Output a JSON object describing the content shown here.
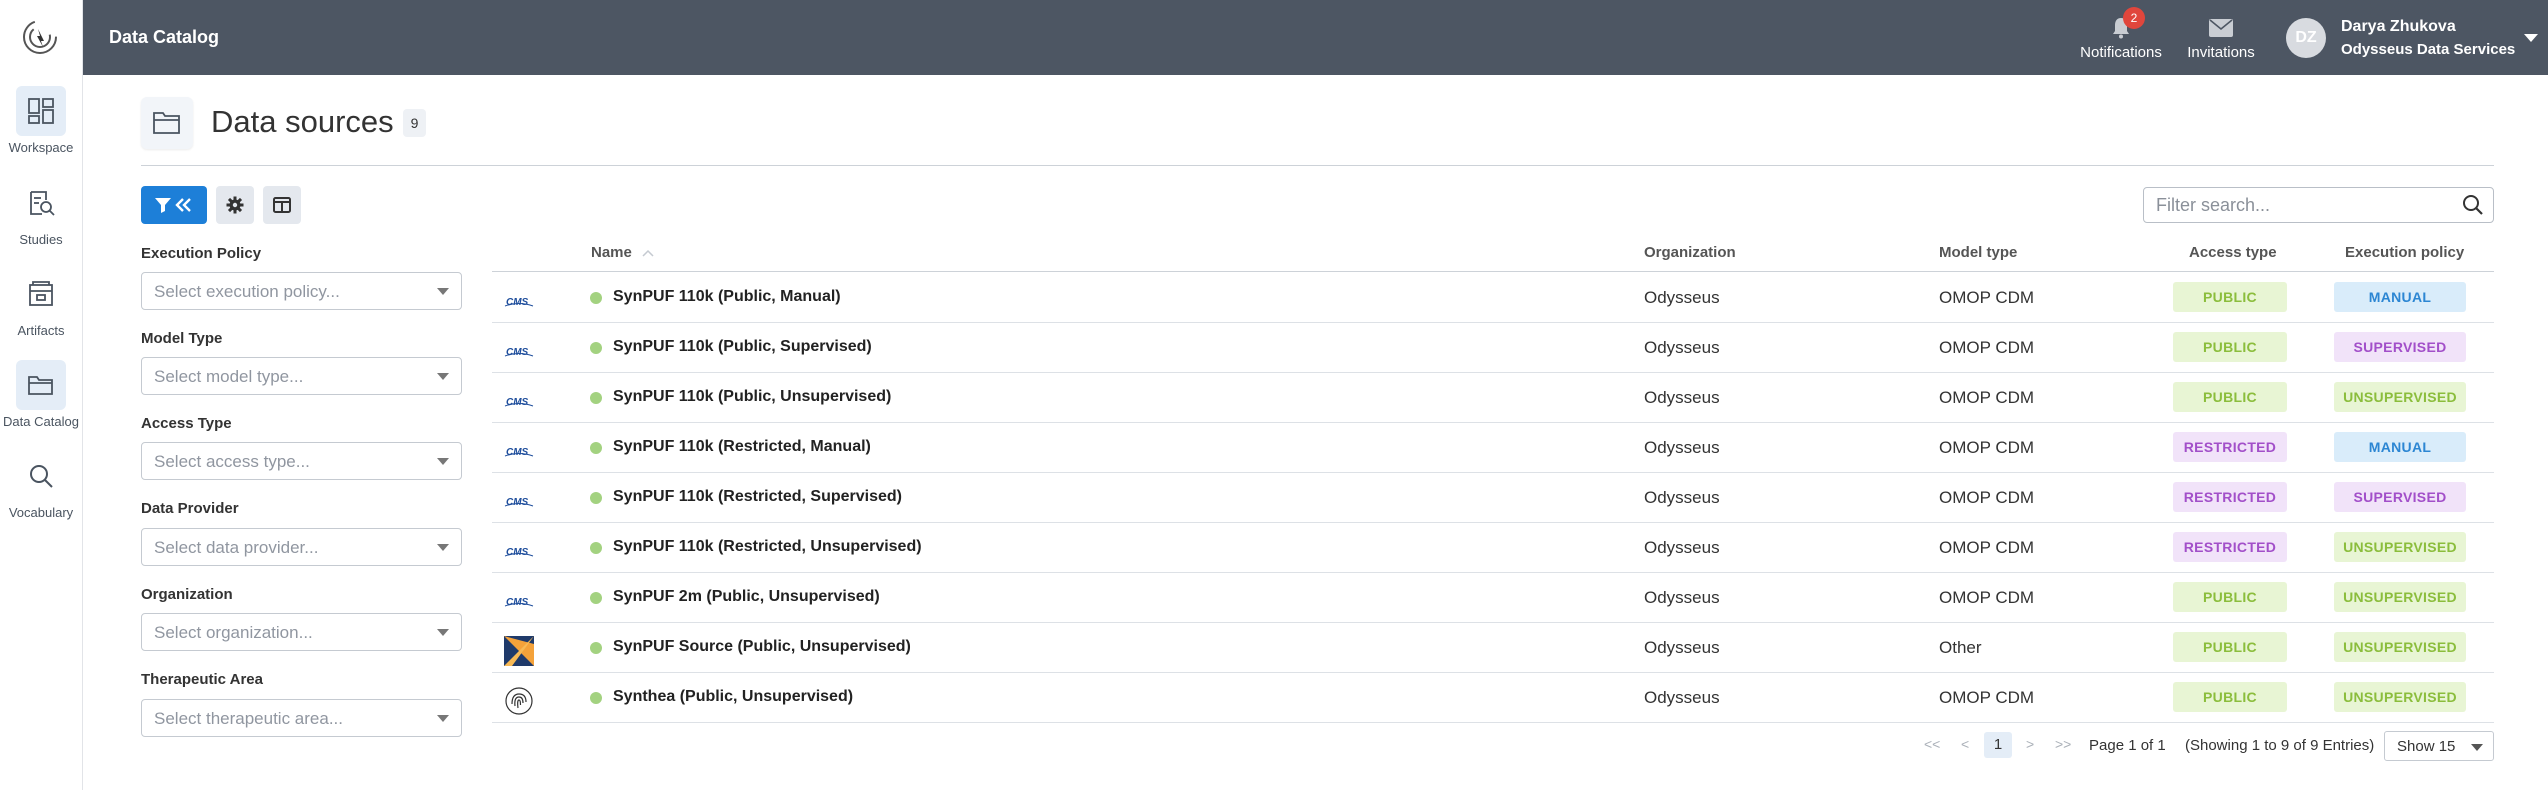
{
  "nav": {
    "items": [
      {
        "label": "Workspace"
      },
      {
        "label": "Studies"
      },
      {
        "label": "Artifacts"
      },
      {
        "label": "Data Catalog"
      },
      {
        "label": "Vocabulary"
      }
    ]
  },
  "topbar": {
    "title": "Data Catalog",
    "notifications_label": "Notifications",
    "notifications_count": "2",
    "invitations_label": "Invitations",
    "avatar_initials": "DZ",
    "user_name": "Darya Zhukova",
    "user_org": "Odysseus Data Services"
  },
  "page": {
    "title": "Data sources",
    "count": "9"
  },
  "search": {
    "placeholder": "Filter search..."
  },
  "filters": [
    {
      "label": "Execution Policy",
      "placeholder": "Select execution policy..."
    },
    {
      "label": "Model Type",
      "placeholder": "Select model type..."
    },
    {
      "label": "Access Type",
      "placeholder": "Select access type..."
    },
    {
      "label": "Data Provider",
      "placeholder": "Select data provider..."
    },
    {
      "label": "Organization",
      "placeholder": "Select organization..."
    },
    {
      "label": "Therapeutic Area",
      "placeholder": "Select therapeutic area..."
    }
  ],
  "table": {
    "headers": {
      "name": "Name",
      "organization": "Organization",
      "model_type": "Model type",
      "access_type": "Access type",
      "execution_policy": "Execution policy"
    },
    "rows": [
      {
        "logo": "cms-logo",
        "name": "SynPUF 110k (Public, Manual)",
        "organization": "Odysseus",
        "model_type": "OMOP CDM",
        "access_type": "PUBLIC",
        "execution_policy": "MANUAL"
      },
      {
        "logo": "cms-logo",
        "name": "SynPUF 110k (Public, Supervised)",
        "organization": "Odysseus",
        "model_type": "OMOP CDM",
        "access_type": "PUBLIC",
        "execution_policy": "SUPERVISED"
      },
      {
        "logo": "cms-logo",
        "name": "SynPUF 110k (Public, Unsupervised)",
        "organization": "Odysseus",
        "model_type": "OMOP CDM",
        "access_type": "PUBLIC",
        "execution_policy": "UNSUPERVISED"
      },
      {
        "logo": "cms-logo",
        "name": "SynPUF 110k (Restricted, Manual)",
        "organization": "Odysseus",
        "model_type": "OMOP CDM",
        "access_type": "RESTRICTED",
        "execution_policy": "MANUAL"
      },
      {
        "logo": "cms-logo",
        "name": "SynPUF 110k (Restricted, Supervised)",
        "organization": "Odysseus",
        "model_type": "OMOP CDM",
        "access_type": "RESTRICTED",
        "execution_policy": "SUPERVISED"
      },
      {
        "logo": "cms-logo",
        "name": "SynPUF 110k (Restricted, Unsupervised)",
        "organization": "Odysseus",
        "model_type": "OMOP CDM",
        "access_type": "RESTRICTED",
        "execution_policy": "UNSUPERVISED"
      },
      {
        "logo": "cms-logo",
        "name": "SynPUF 2m (Public, Unsupervised)",
        "organization": "Odysseus",
        "model_type": "OMOP CDM",
        "access_type": "PUBLIC",
        "execution_policy": "UNSUPERVISED"
      },
      {
        "logo": "orange-x-logo",
        "name": "SynPUF Source (Public, Unsupervised)",
        "organization": "Odysseus",
        "model_type": "Other",
        "access_type": "PUBLIC",
        "execution_policy": "UNSUPERVISED"
      },
      {
        "logo": "fingerprint-logo",
        "name": "Synthea (Public, Unsupervised)",
        "organization": "Odysseus",
        "model_type": "OMOP CDM",
        "access_type": "PUBLIC",
        "execution_policy": "UNSUPERVISED"
      }
    ]
  },
  "pagination": {
    "first": "<<",
    "prev": "<",
    "current": "1",
    "next": ">",
    "last": ">>",
    "page_info": "Page 1 of 1",
    "showing": "(Showing 1 to 9 of 9 Entries)",
    "page_size": "Show 15"
  },
  "colors": {
    "topbar": "#4d5663",
    "primary": "#1d7fd8",
    "public": "#8bbd3c",
    "restricted": "#a24fc9",
    "manual": "#2c86d3",
    "status_dot": "#a3d280"
  }
}
